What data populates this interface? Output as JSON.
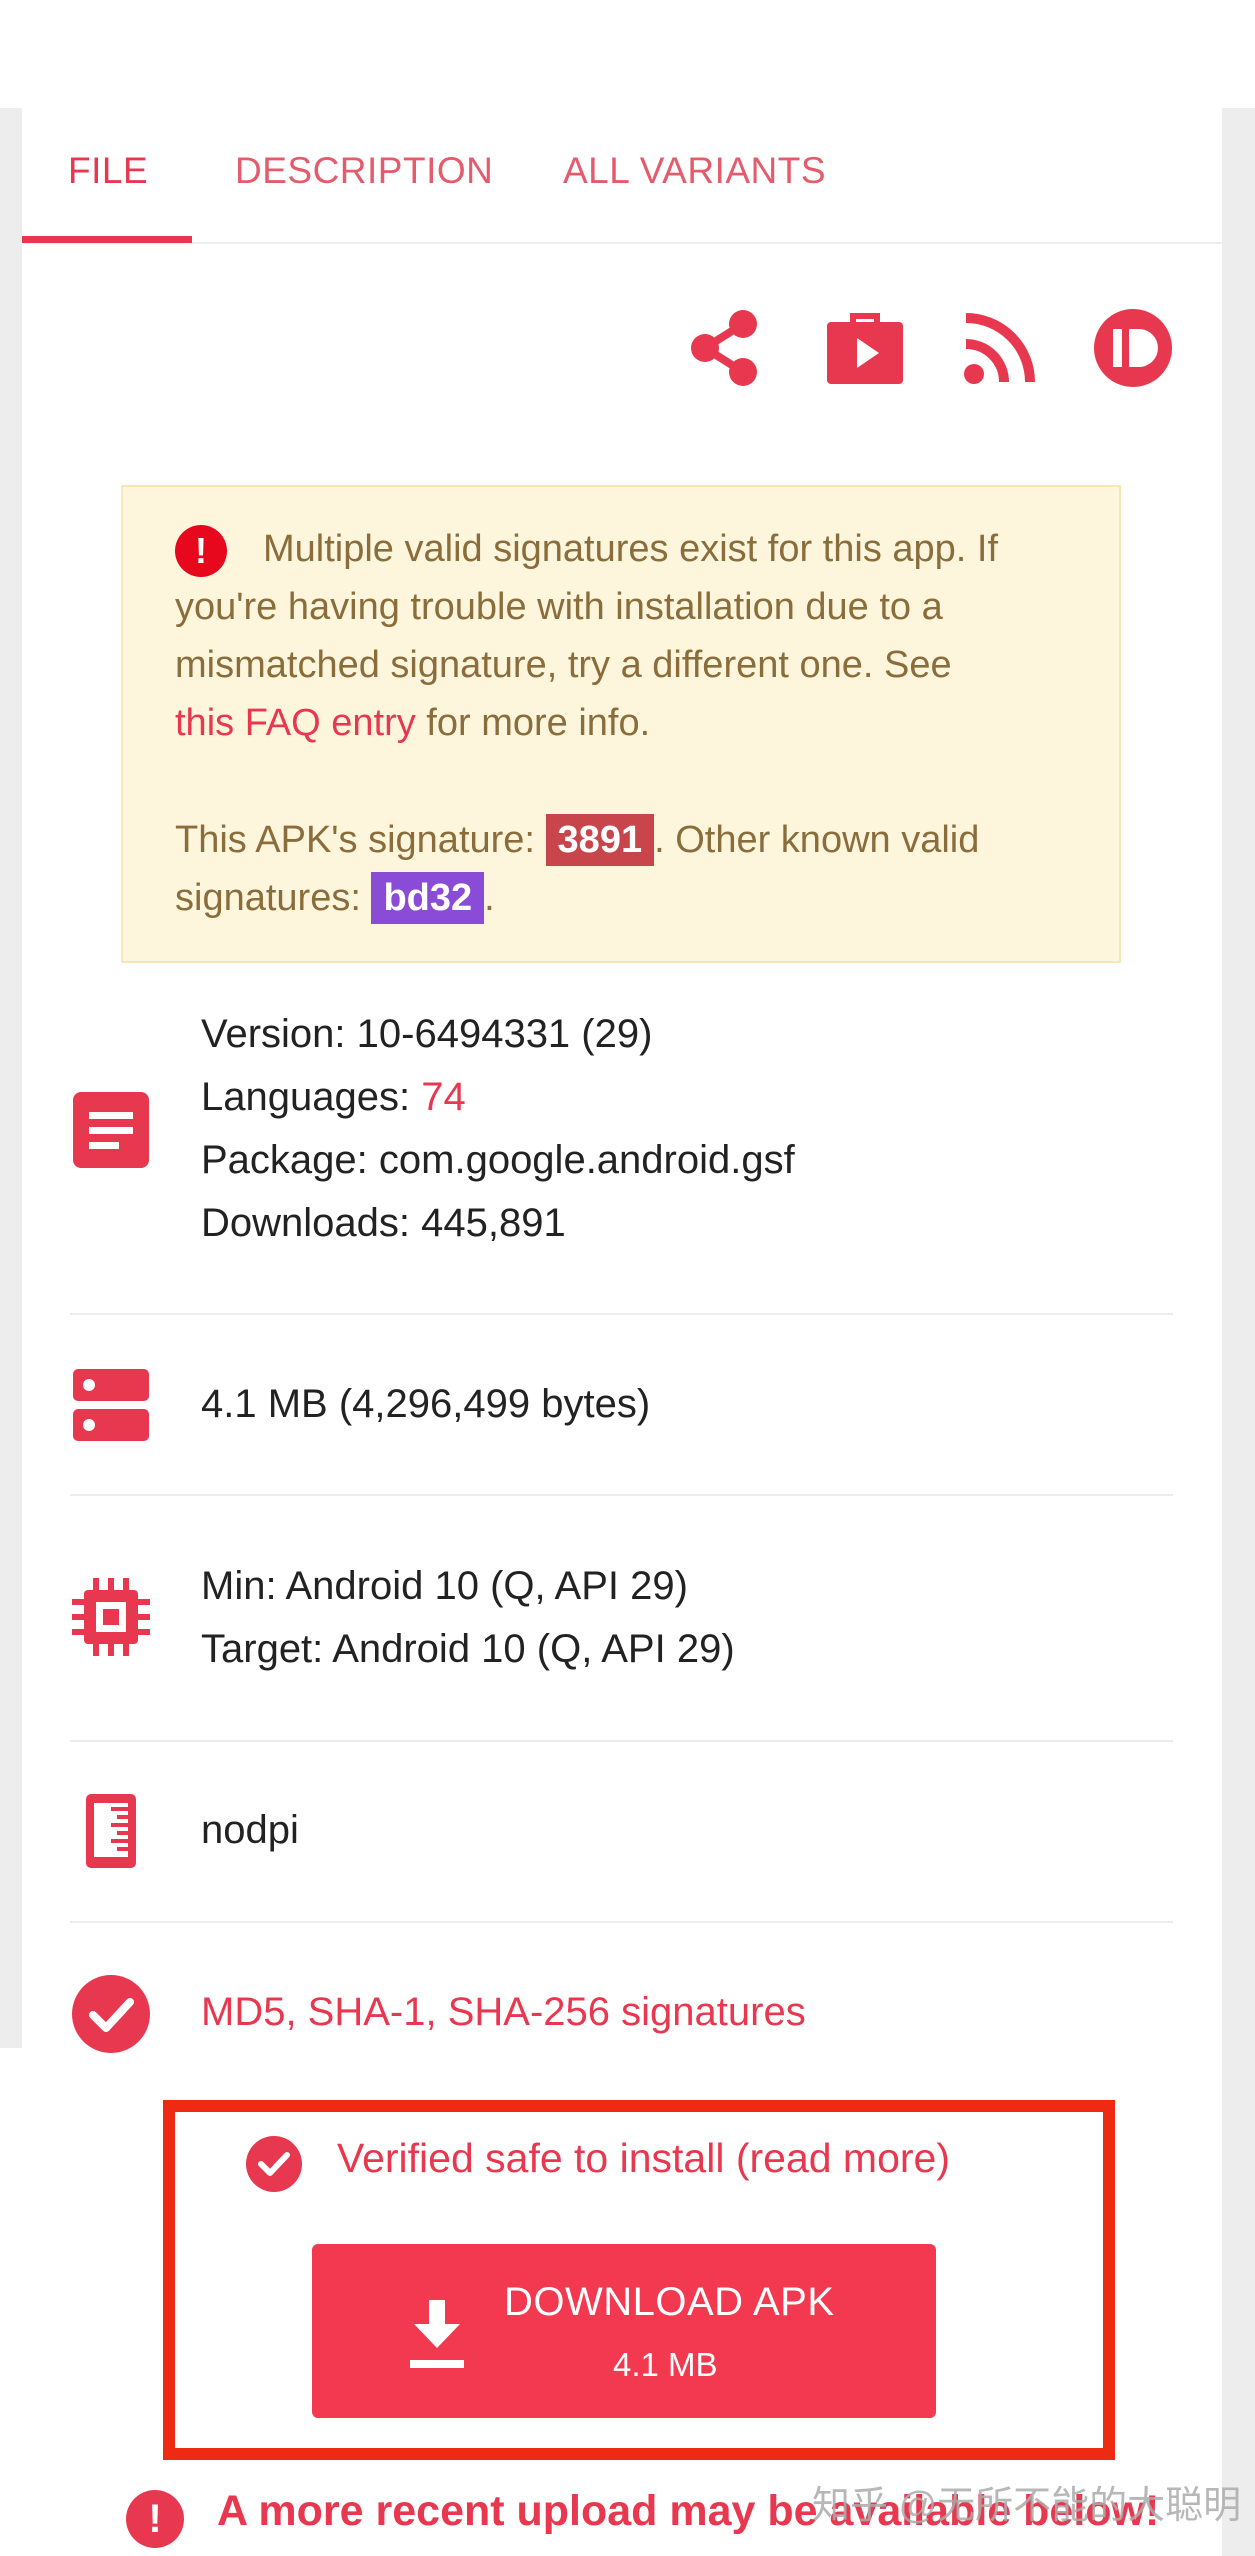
{
  "tabs": [
    {
      "label": "FILE",
      "active": true
    },
    {
      "label": "DESCRIPTION",
      "active": false
    },
    {
      "label": "ALL VARIANTS",
      "active": false
    }
  ],
  "top_icons": [
    "share-icon",
    "play-store-icon",
    "rss-icon",
    "pushbullet-icon"
  ],
  "warning": {
    "line1": "Multiple valid signatures exist for this app. If",
    "line2": "you're having trouble with installation due to a",
    "line3": "mismatched signature, try a different one. See",
    "faq_link": "this FAQ entry",
    "line4_rest": " for more info.",
    "sig_prefix": "This APK's signature: ",
    "sig_value": "3891",
    "sig_mid": ". Other known valid",
    "other_prefix": "signatures: ",
    "other_value": "bd32",
    "other_suffix": "."
  },
  "info": {
    "version": "Version: 10-6494331 (29)",
    "languages_label": "Languages: ",
    "languages_value": "74",
    "package": "Package: com.google.android.gsf",
    "downloads": "Downloads: 445,891",
    "size": "4.1 MB (4,296,499 bytes)",
    "min": "Min: Android 10 (Q, API 29)",
    "target": "Target: Android 10 (Q, API 29)",
    "dpi": "nodpi",
    "signatures": "MD5, SHA-1, SHA-256 signatures"
  },
  "verified": "Verified safe to install (read more)",
  "download": {
    "label": "DOWNLOAD APK",
    "size": "4.1 MB"
  },
  "recent_notice": "A more recent upload may be available below!",
  "watermark": "知乎 @无所不能的大聪明",
  "colors": {
    "accent": "#e8384f",
    "warning_bg": "#fdf6dd",
    "warning_text": "#8a6d3b",
    "sig_a": "#c8464b",
    "sig_b": "#8a4bd6",
    "frame": "#ee2a13"
  }
}
